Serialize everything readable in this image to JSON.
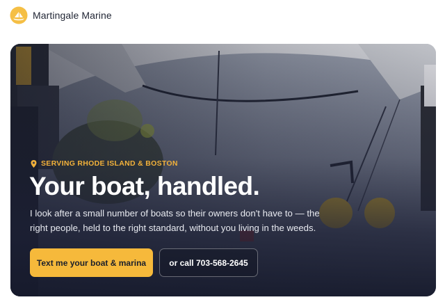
{
  "brand": {
    "name": "Martingale Marine"
  },
  "hero": {
    "eyebrow": "SERVING RHODE ISLAND & BOSTON",
    "headline": "Your boat, handled.",
    "subtext": "I look after a small number of boats so their owners don't have to — the right people, held to the right standard, without you living in the weeds.",
    "primary_cta": "Text me your boat & marina",
    "secondary_cta": "or call 703-568-2645"
  },
  "colors": {
    "accent": "#f6b93b",
    "eyebrow": "#f2b13a",
    "hero_overlay": "#1c2035"
  },
  "icons": {
    "logo": "martingale-logo-icon",
    "eyebrow": "location-pin-icon"
  }
}
